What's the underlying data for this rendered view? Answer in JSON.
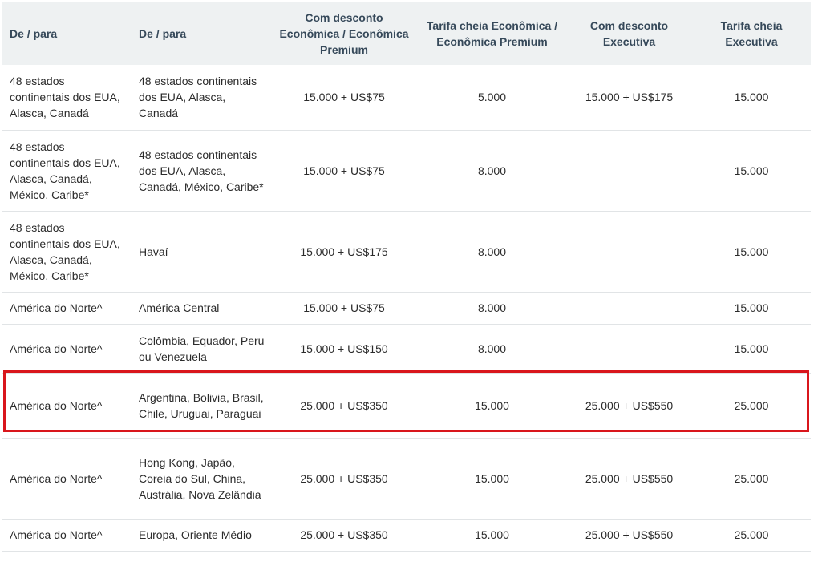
{
  "table": {
    "headers": [
      "De / para",
      "De / para",
      "Com desconto Econômica / Econômica Premium",
      "Tarifa cheia Econômica / Econômica Premium",
      "Com desconto Executiva",
      "Tarifa cheia Executiva"
    ],
    "rows": [
      [
        "48 estados continentais dos EUA, Alasca, Canadá",
        "48 estados continentais dos EUA, Alasca, Canadá",
        "15.000 + US$75",
        "5.000",
        "15.000 + US$175",
        "15.000"
      ],
      [
        "48 estados continentais dos EUA, Alasca, Canadá, México, Caribe*",
        "48 estados continentais dos EUA, Alasca, Canadá, México, Caribe*",
        "15.000 + US$75",
        "8.000",
        "—",
        "15.000"
      ],
      [
        "48 estados continentais dos EUA, Alasca, Canadá, México, Caribe*",
        "Havaí",
        "15.000 + US$175",
        "8.000",
        "—",
        "15.000"
      ],
      [
        "América do Norte^",
        "América Central",
        "15.000 + US$75",
        "8.000",
        "—",
        "15.000"
      ],
      [
        "América do Norte^",
        "Colômbia, Equador, Peru ou Venezuela",
        "15.000 + US$150",
        "8.000",
        "—",
        "15.000"
      ],
      [
        "América do Norte^",
        "Argentina, Bolivia, Brasil, Chile, Uruguai, Paraguai",
        "25.000 + US$350",
        "15.000",
        "25.000 + US$550",
        "25.000"
      ],
      [
        "América do Norte^",
        "Hong Kong, Japão, Coreia do Sul, China, Austrália, Nova Zelândia",
        "25.000 + US$350",
        "15.000",
        "25.000 + US$550",
        "25.000"
      ],
      [
        "América do Norte^",
        "Europa, Oriente Médio",
        "25.000 + US$350",
        "15.000",
        "25.000 + US$550",
        "25.000"
      ]
    ],
    "highlighted_row": 5,
    "highlight_color": "#d9161c"
  }
}
